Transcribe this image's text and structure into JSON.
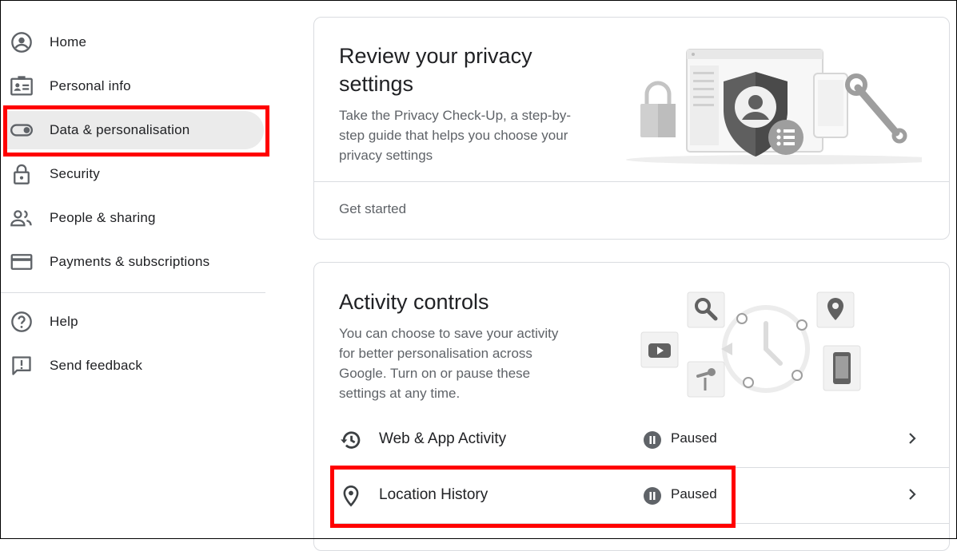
{
  "sidebar": {
    "items": [
      {
        "label": "Home",
        "icon": "account-circle-icon"
      },
      {
        "label": "Personal info",
        "icon": "id-card-icon"
      },
      {
        "label": "Data & personalisation",
        "icon": "toggle-icon"
      },
      {
        "label": "Security",
        "icon": "lock-icon"
      },
      {
        "label": "People & sharing",
        "icon": "people-icon"
      },
      {
        "label": "Payments & subscriptions",
        "icon": "credit-card-icon"
      }
    ],
    "secondary": [
      {
        "label": "Help",
        "icon": "help-icon"
      },
      {
        "label": "Send feedback",
        "icon": "feedback-icon"
      }
    ],
    "active_index": 2
  },
  "privacy_card": {
    "title_line1": "Review your privacy",
    "title_line2": "settings",
    "desc_line1": "Take the Privacy Check-Up, a step-by-",
    "desc_line2": "step guide that helps you choose your",
    "desc_line3": "privacy settings",
    "action": "Get started"
  },
  "activity_card": {
    "title": "Activity controls",
    "desc_line1": "You can choose to save your activity",
    "desc_line2": "for better personalisation across",
    "desc_line3": "Google. Turn on or pause these",
    "desc_line4": "settings at any time.",
    "rows": [
      {
        "label": "Web & App Activity",
        "status": "Paused",
        "icon": "history-icon"
      },
      {
        "label": "Location History",
        "status": "Paused",
        "icon": "location-pin-icon"
      }
    ]
  },
  "colors": {
    "highlight_box": "#ff0000",
    "active_nav_bg": "#ebebeb",
    "text_primary": "#202124",
    "text_secondary": "#5f6368"
  }
}
